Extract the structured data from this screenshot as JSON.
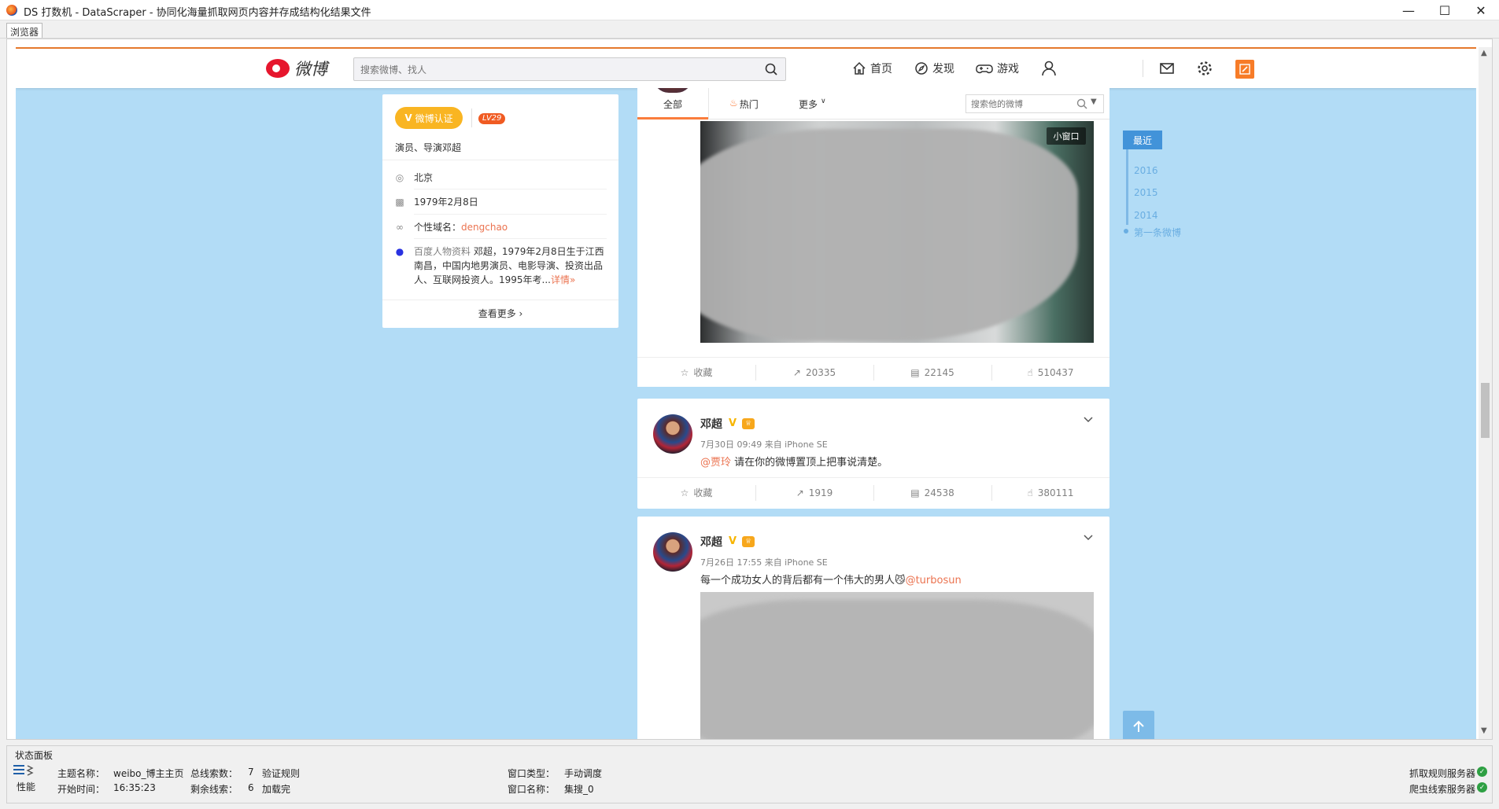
{
  "window": {
    "title": "DS 打数机 - DataScraper - 协同化海量抓取网页内容并存成结构化结果文件",
    "tab": "浏览器"
  },
  "weibo": {
    "logo_text": "微博",
    "search_placeholder": "搜索微博、找人",
    "nav": [
      {
        "label": "首页",
        "icon": "home-icon"
      },
      {
        "label": "发现",
        "icon": "compass-icon"
      },
      {
        "label": "游戏",
        "icon": "gamepad-icon"
      }
    ],
    "profile": {
      "verified_label": "微博认证",
      "level": "LV29",
      "intro": "演员、导演邓超",
      "location": "北京",
      "birthday": "1979年2月8日",
      "domain_label": "个性域名：",
      "domain_value": "dengchao",
      "baike_source": "百度人物资料",
      "baike_text_1": " 邓超，1979年2月8日生于江西南昌，中国内地男演员、电影导演、投资出品人、互联网投资人。1995年考...",
      "baike_more": "详情»",
      "see_more": "查看更多 ›"
    },
    "feed_tabs": {
      "all": "全部",
      "hot": "热门",
      "more": "更多",
      "search_placeholder": "搜索他的微博"
    },
    "posts": [
      {
        "mini_window": "小窗口",
        "actions": {
          "fav": "收藏",
          "repost": "20335",
          "comment": "22145",
          "like": "510437"
        }
      },
      {
        "author": "邓超",
        "vbadge": "V",
        "meta": "7月30日 09:49 来自 iPhone SE",
        "mention": "@贾玲",
        "text": " 请在你的微博置顶上把事说清楚。",
        "actions": {
          "fav": "收藏",
          "repost": "1919",
          "comment": "24538",
          "like": "380111"
        }
      },
      {
        "author": "邓超",
        "vbadge": "V",
        "meta": "7月26日 17:55 来自 iPhone SE",
        "text": "每一个成功女人的背后都有一个伟大的男人",
        "emoji": "😼",
        "mention": "@turbosun"
      }
    ],
    "timeline": {
      "recent": "最近",
      "years": [
        "2016",
        "2015",
        "2014"
      ],
      "first": "第一条微博"
    }
  },
  "status_panel": {
    "title": "状态面板",
    "perf_label": "性能",
    "theme_label": "主题名称：",
    "theme_value": "weibo_博主主页",
    "total_label": "总线索数：",
    "total_value": "7",
    "verify_label": "验证规则",
    "start_label": "开始时间：",
    "start_value": "16:35:23",
    "remain_label": "剩余线索：",
    "remain_value": "6",
    "loaded_label": "加载完",
    "wintype_label": "窗口类型：",
    "wintype_value": "手动调度",
    "winname_label": "窗口名称：",
    "winname_value": "集搜_0",
    "server1": "抓取规则服务器",
    "server2": "爬虫线索服务器"
  },
  "colors": {
    "weibo_orange": "#fa7d3c",
    "weibo_bg": "#b2dcf6",
    "link": "#eb7350",
    "timeline_blue": "#4293d9"
  }
}
